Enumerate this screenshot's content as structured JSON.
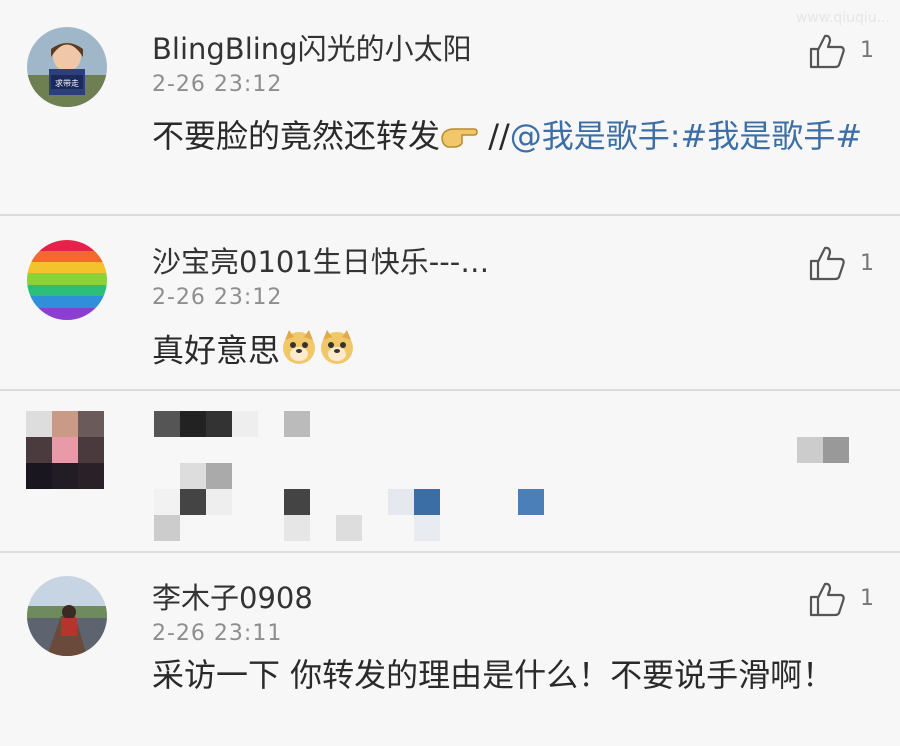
{
  "watermark": "www.qiuqiu...",
  "comments": [
    {
      "name": "BlingBling闪光的小太阳",
      "time": "2-26 23:12",
      "text": "不要脸的竟然还转发",
      "mention_prefix": "//",
      "mention": "@我是歌手",
      "hashtag": ":#我是歌手#",
      "likes": "1",
      "avatar_sign": "求带走"
    },
    {
      "name": "沙宝亮0101生日快乐---…",
      "time": "2-26 23:12",
      "text": "真好意思",
      "likes": "1"
    },
    {
      "name": "",
      "time": "",
      "text": "",
      "likes": "",
      "redacted": true
    },
    {
      "name": "李木子0908",
      "time": "2-26 23:11",
      "text": "采访一下  你转发的理由是什么！不要说手滑啊！",
      "likes": "1"
    }
  ],
  "colors": {
    "background": "#f7f7f7",
    "divider": "#dcdcdc",
    "link": "#3d6fa6",
    "time": "#8e8e8e"
  },
  "icons": {
    "like": "thumbs-up-outline-icon",
    "emoji": "doge-emoji",
    "pointing_hand": "pointing-right-emoji"
  }
}
